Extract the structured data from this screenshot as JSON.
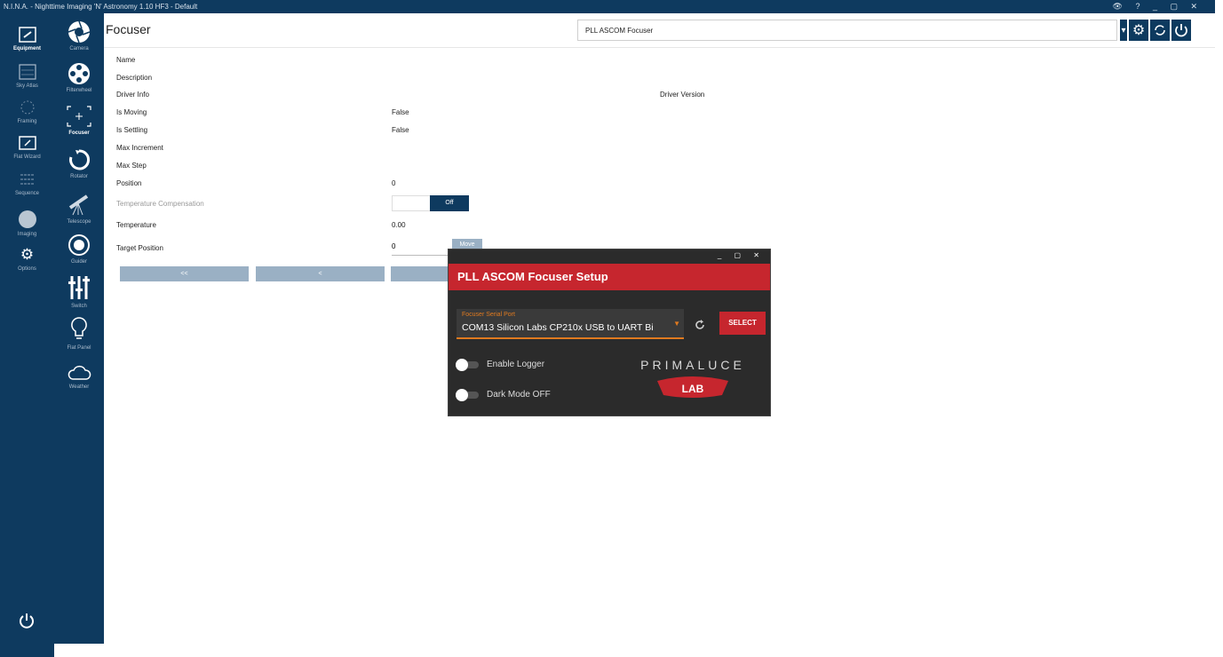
{
  "window": {
    "title": "N.I.N.A. - Nighttime Imaging 'N' Astronomy 1.10 HF3 - Default",
    "controls": "👁 ? _ ▢ ✕"
  },
  "nav_primary": [
    {
      "label": "Equipment",
      "icon": "telescope-frame-icon",
      "active": true
    },
    {
      "label": "Sky Atlas",
      "icon": "sky-map-icon"
    },
    {
      "label": "Framing",
      "icon": "framing-icon"
    },
    {
      "label": "Flat Wizard",
      "icon": "flat-wizard-icon"
    },
    {
      "label": "Sequence",
      "icon": "sequence-icon"
    },
    {
      "label": "Imaging",
      "icon": "imaging-icon"
    },
    {
      "label": "Options",
      "icon": "options-gear-icon"
    }
  ],
  "nav_secondary": [
    {
      "label": "Camera",
      "icon": "camera-aperture-icon"
    },
    {
      "label": "Filterwheel",
      "icon": "filterwheel-icon"
    },
    {
      "label": "Focuser",
      "icon": "focuser-icon",
      "active": true
    },
    {
      "label": "Rotator",
      "icon": "rotator-icon"
    },
    {
      "label": "Telescope",
      "icon": "telescope-icon"
    },
    {
      "label": "Guider",
      "icon": "guider-icon"
    },
    {
      "label": "Switch",
      "icon": "switch-sliders-icon"
    },
    {
      "label": "Flat Panel",
      "icon": "flat-panel-bulb-icon"
    },
    {
      "label": "Weather",
      "icon": "weather-cloud-icon"
    }
  ],
  "header": {
    "title": "Focuser",
    "device": "PLL ASCOM Focuser",
    "dropdown_glyph": "▾"
  },
  "properties": [
    {
      "label": "Name",
      "value": ""
    },
    {
      "label": "Description",
      "value": ""
    },
    {
      "label": "Driver Info",
      "value": ""
    },
    {
      "label": "Is Moving",
      "value": "False"
    },
    {
      "label": "Is Settling",
      "value": "False"
    },
    {
      "label": "Max Increment",
      "value": ""
    },
    {
      "label": "Max Step",
      "value": ""
    },
    {
      "label": "Position",
      "value": "0"
    },
    {
      "label": "Temperature Compensation",
      "value": ""
    },
    {
      "label": "Temperature",
      "value": "0.00"
    },
    {
      "label": "Target Position",
      "value": ""
    }
  ],
  "driver_version_label": "Driver Version",
  "temp_comp": {
    "off_label": "Off"
  },
  "target": {
    "value": "0",
    "move_label": "Move"
  },
  "step_buttons": [
    "<<",
    "<",
    ""
  ],
  "dialog": {
    "controls": "_ ▢ ✕",
    "title": "PLL ASCOM Focuser Setup",
    "port_label": "Focuser Serial Port",
    "port_value": "COM13  Silicon Labs CP210x USB to UART Bi",
    "select_label": "SELECT",
    "logger_label": "Enable Logger",
    "dark_mode_label": "Dark Mode OFF",
    "logo_top": "PRIMALUCE",
    "logo_bottom": "LAB"
  },
  "colors": {
    "nav": "#0e3a5f",
    "accent": "#c6262e",
    "orange": "#e07a1f"
  }
}
